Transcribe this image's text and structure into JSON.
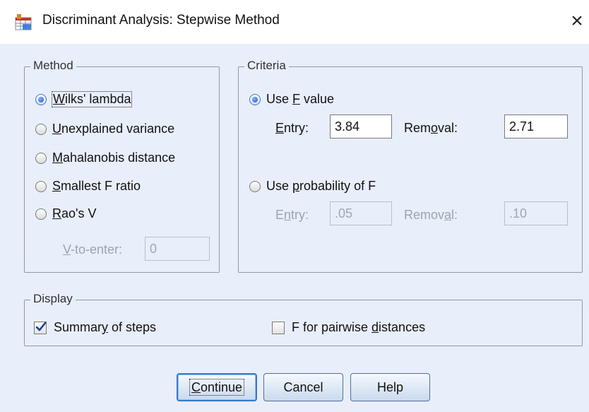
{
  "window": {
    "title": "Discriminant Analysis: Stepwise Method",
    "close_glyph": "×",
    "icon": "spss-table-icon"
  },
  "method": {
    "legend": "Method",
    "options": [
      {
        "pre": "",
        "key": "W",
        "post": "ilks' lambda",
        "selected": true
      },
      {
        "pre": "",
        "key": "U",
        "post": "nexplained variance",
        "selected": false
      },
      {
        "pre": "",
        "key": "M",
        "post": "ahalanobis distance",
        "selected": false
      },
      {
        "pre": "",
        "key": "S",
        "post": "mallest F ratio",
        "selected": false
      },
      {
        "pre": "",
        "key": "R",
        "post": "ao's V",
        "selected": false
      }
    ],
    "v_to_enter": {
      "key": "V",
      "post": "-to-enter:",
      "value": "0",
      "enabled": false
    }
  },
  "criteria": {
    "legend": "Criteria",
    "use_f_value": {
      "pre": "Use ",
      "key": "F",
      "post": " value",
      "selected": true
    },
    "f_entry": {
      "key": "E",
      "post": "ntry:",
      "value": "3.84"
    },
    "f_removal": {
      "pre": "Rem",
      "key": "o",
      "post": "val:",
      "value": "2.71"
    },
    "use_probability": {
      "pre": "Use ",
      "key": "p",
      "post": "robability of F",
      "selected": false
    },
    "p_entry": {
      "pre": "E",
      "key": "n",
      "post": "try:",
      "value": ".05",
      "enabled": false
    },
    "p_removal": {
      "pre": "Remov",
      "key": "a",
      "post": "l:",
      "value": ".10",
      "enabled": false
    }
  },
  "display": {
    "legend": "Display",
    "summary": {
      "pre": "Summar",
      "key": "y",
      "post": " of steps",
      "checked": true
    },
    "pairwise": {
      "pre": "F for pairwise ",
      "key": "d",
      "post": "istances",
      "checked": false
    }
  },
  "buttons": {
    "continue": {
      "key": "C",
      "post": "ontinue"
    },
    "cancel": "Cancel",
    "help": "Help"
  },
  "colors": {
    "dialog_bg": "#e8eefa",
    "accent": "#3a79c9",
    "check": "#1b3f8f"
  }
}
